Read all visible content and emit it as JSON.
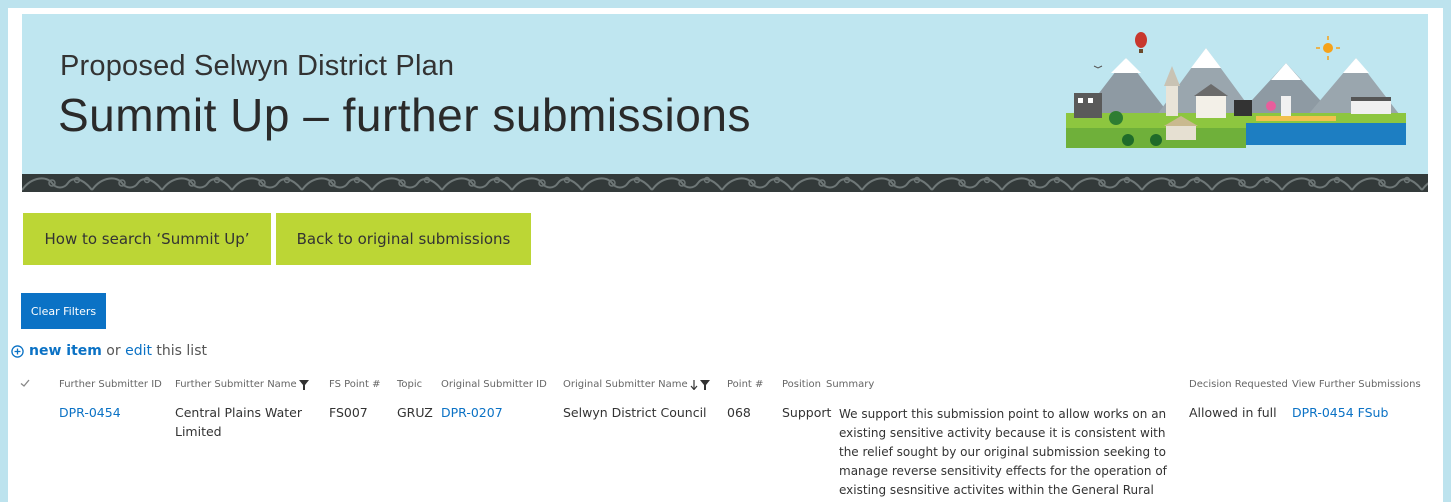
{
  "banner": {
    "subtitle": "Proposed Selwyn District Plan",
    "title": "Summit Up – further submissions"
  },
  "buttons": {
    "how_to_search": "How to search ‘Summit Up’",
    "back": "Back to original submissions",
    "clear_filters": "Clear Filters"
  },
  "toolbar": {
    "new_item": "new item",
    "or": " or ",
    "edit": "edit",
    "this_list": " this list"
  },
  "table": {
    "columns": [
      "Further Submitter ID",
      "Further Submitter Name",
      "FS Point #",
      "Topic",
      "Original Submitter ID",
      "Original Submitter Name",
      "Point #",
      "Position",
      "Summary",
      "Decision Requested",
      "View Further Submissions"
    ],
    "rows": [
      {
        "further_submitter_id": "DPR-0454",
        "further_submitter_name": "Central Plains Water Limited",
        "fs_point": "FS007",
        "topic": "GRUZ",
        "original_submitter_id": "DPR-0207",
        "original_submitter_name": "Selwyn District Council",
        "point": "068",
        "position": "Support",
        "summary": "We support this submission point to allow works on an existing sensitive activity because it is consistent with the relief sought by our original submission seeking to manage reverse sensitivity effects for the operation of existing sesnsitive activites within the General Rural Zone.",
        "decision_requested": "Allowed in full",
        "view_further_submissions": "DPR-0454 FSub"
      }
    ]
  },
  "colors": {
    "background": "#bde3ee",
    "banner": "#bfe6f0",
    "green_button": "#bcd635",
    "blue_button": "#0b72c5",
    "link": "#0b72c5",
    "pattern_band": "#333a3a"
  },
  "icons": {
    "add": "plus-circle-icon",
    "filter": "filter-icon",
    "sort": "sort-down-arrow-icon",
    "select": "checkmark-icon"
  }
}
